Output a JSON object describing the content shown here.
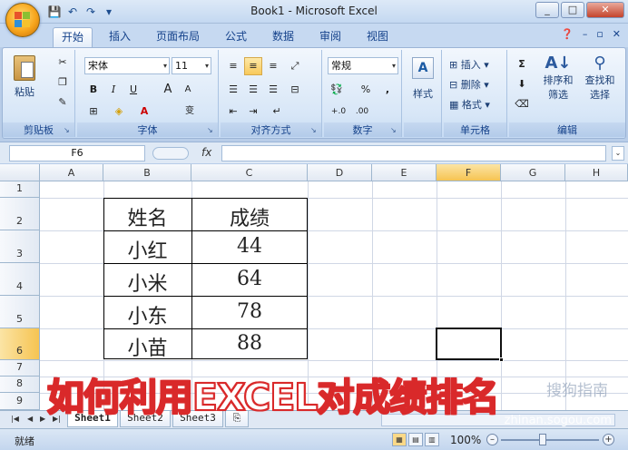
{
  "window": {
    "title": "Book1 - Microsoft Excel",
    "minimize": "_",
    "maximize": "□",
    "close": "✕"
  },
  "qat": {
    "save": "💾",
    "undo": "↶",
    "redo": "↷",
    "more": "▾"
  },
  "tabs": [
    "开始",
    "插入",
    "页面布局",
    "公式",
    "数据",
    "审阅",
    "视图"
  ],
  "ribbon": {
    "clipboard": {
      "label": "剪贴板",
      "paste": "粘贴"
    },
    "font": {
      "label": "字体",
      "name": "宋体",
      "size": "11",
      "bold": "B",
      "italic": "I",
      "underline": "U",
      "grow": "A",
      "shrink": "A",
      "phonetic": "变"
    },
    "alignment": {
      "label": "对齐方式"
    },
    "number": {
      "label": "数字",
      "format": "常规",
      "percent": "%",
      "comma": ",",
      "inc": "+.0",
      "dec": ".00"
    },
    "styles": {
      "label": "样式"
    },
    "cells": {
      "label": "单元格",
      "insert": "插入",
      "delete": "删除",
      "format": "格式"
    },
    "editing": {
      "label": "编辑",
      "sort": "排序和",
      "sort2": "筛选",
      "find": "查找和",
      "find2": "选择"
    }
  },
  "formula_bar": {
    "name_box": "F6",
    "fx": "fx",
    "value": ""
  },
  "columns": [
    "A",
    "B",
    "C",
    "D",
    "E",
    "F",
    "G",
    "H"
  ],
  "rows": [
    "1",
    "2",
    "3",
    "4",
    "5",
    "6",
    "7",
    "8",
    "9"
  ],
  "table": {
    "headers": [
      "姓名",
      "成绩"
    ],
    "names": [
      "小红",
      "小米",
      "小东",
      "小苗"
    ],
    "scores": [
      "44",
      "64",
      "78",
      "88"
    ]
  },
  "overlay_caption": "如何利用EXCEL对成绩排名",
  "watermark": "搜狗指南",
  "watermark_url": "zhinan.sogou.com",
  "sheets": [
    "Sheet1",
    "Sheet2",
    "Sheet3"
  ],
  "status": {
    "ready": "就绪",
    "zoom": "100%"
  },
  "colors": {
    "overlay_text": "#ffffff",
    "overlay_outline": "#d9292a",
    "selection": "#f6c452"
  }
}
